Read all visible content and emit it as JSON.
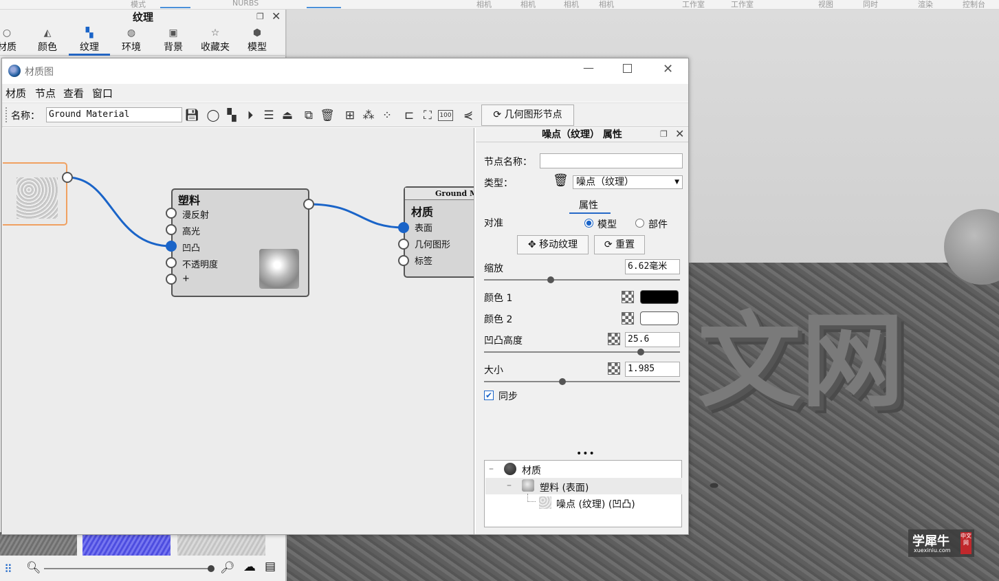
{
  "top_strip": {
    "items": [
      "模式",
      "NURBS",
      "相机",
      "相机",
      "相机",
      "相机",
      "工作室",
      "工作室",
      "视图",
      "同时",
      "渲染",
      "控制台"
    ]
  },
  "left_panel": {
    "title": "纹理",
    "tabs": [
      {
        "label": "材质",
        "icon": "sphere-icon"
      },
      {
        "label": "颜色",
        "icon": "palette-icon"
      },
      {
        "label": "纹理",
        "icon": "texture-icon"
      },
      {
        "label": "环境",
        "icon": "globe-icon"
      },
      {
        "label": "背景",
        "icon": "image-icon"
      },
      {
        "label": "收藏夹",
        "icon": "star-icon"
      },
      {
        "label": "模型",
        "icon": "cubes-icon"
      }
    ],
    "selected_tab": "纹理",
    "thumb_colors": [
      "#7c7c7c",
      "#5a5ae6",
      "#cfcfcf"
    ]
  },
  "window": {
    "title": "材质图",
    "menus": [
      "材质",
      "节点",
      "查看",
      "窗口"
    ],
    "name_label": "名称：",
    "name_value": "Ground Material",
    "geometry_node_button": "几何图形节点",
    "zoom_badge": "100"
  },
  "nodes": {
    "plastic": {
      "title": "塑料",
      "inputs": [
        "漫反射",
        "高光",
        "凹凸",
        "不透明度",
        "+"
      ]
    },
    "material": {
      "title": "材质",
      "header": "Ground M",
      "inputs": [
        "表面",
        "几何图形",
        "标签"
      ]
    }
  },
  "properties": {
    "title": "噪点（纹理） 属性",
    "node_name_label": "节点名称：",
    "node_name_value": "",
    "type_label": "类型：",
    "type_value": "噪点（纹理）",
    "tab": "属性",
    "align_label": "对准",
    "align_options": [
      "模型",
      "部件"
    ],
    "align_selected": "模型",
    "move_texture_button": "移动纹理",
    "reset_button": "重置",
    "scale_label": "缩放",
    "scale_value": "6.62毫米",
    "scale_slider": 0.34,
    "color1_label": "颜色 1",
    "color1": "#000000",
    "color2_label": "颜色 2",
    "color2": "#ffffff",
    "bump_label": "凹凸高度",
    "bump_value": "25.6",
    "bump_slider": 0.8,
    "size_label": "大小",
    "size_value": "1.985",
    "size_slider": 0.4,
    "sync_label": "同步",
    "sync_checked": true,
    "tree": [
      {
        "label": "材质",
        "level": 0
      },
      {
        "label": "塑料 (表面)",
        "level": 1
      },
      {
        "label": "噪点 (纹理) (凹凸)",
        "level": 2
      }
    ]
  },
  "viewport": {
    "text": "文网"
  },
  "watermark": {
    "main": "学犀牛",
    "sub": "xuexiniu.com",
    "badge": "中文网"
  }
}
